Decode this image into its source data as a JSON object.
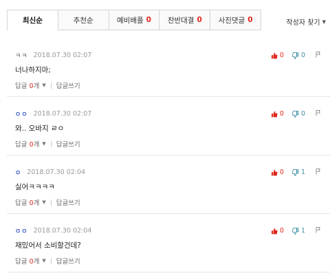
{
  "tabs": [
    {
      "label": "최신순",
      "count": ""
    },
    {
      "label": "추천순",
      "count": ""
    },
    {
      "label": "예비배플",
      "count": "0"
    },
    {
      "label": "찬반대결",
      "count": "0"
    },
    {
      "label": "사진댓글",
      "count": "0"
    }
  ],
  "author_find_label": "작성자 찾기",
  "reply_label": "답글",
  "reply_unit": "개",
  "write_reply_label": "답글쓰기",
  "comments": [
    {
      "nick": "ㅋㅋ",
      "date": "2018.07.30 02:07",
      "text": "너나하지마;",
      "replies": "0",
      "likes": "0",
      "dislikes": "0"
    },
    {
      "nick": "ㅇㅇ",
      "date": "2018.07.30 02:07",
      "text": "와.. 오바지 ㄹㅇ",
      "replies": "0",
      "likes": "0",
      "dislikes": "0"
    },
    {
      "nick": "ㅇ",
      "date": "2018.07.30 02:04",
      "text": "싫어ㅋㅋㅋㅋ",
      "replies": "0",
      "likes": "0",
      "dislikes": "1"
    },
    {
      "nick": "ㅇㅇ",
      "date": "2018.07.30 02:04",
      "text": "재밌어서 소비할건데?",
      "replies": "0",
      "likes": "0",
      "dislikes": "1"
    }
  ],
  "colors": {
    "accent": "#e1261c",
    "dislike": "#3a8ea0",
    "nick_blue": "#3a5cc7"
  }
}
